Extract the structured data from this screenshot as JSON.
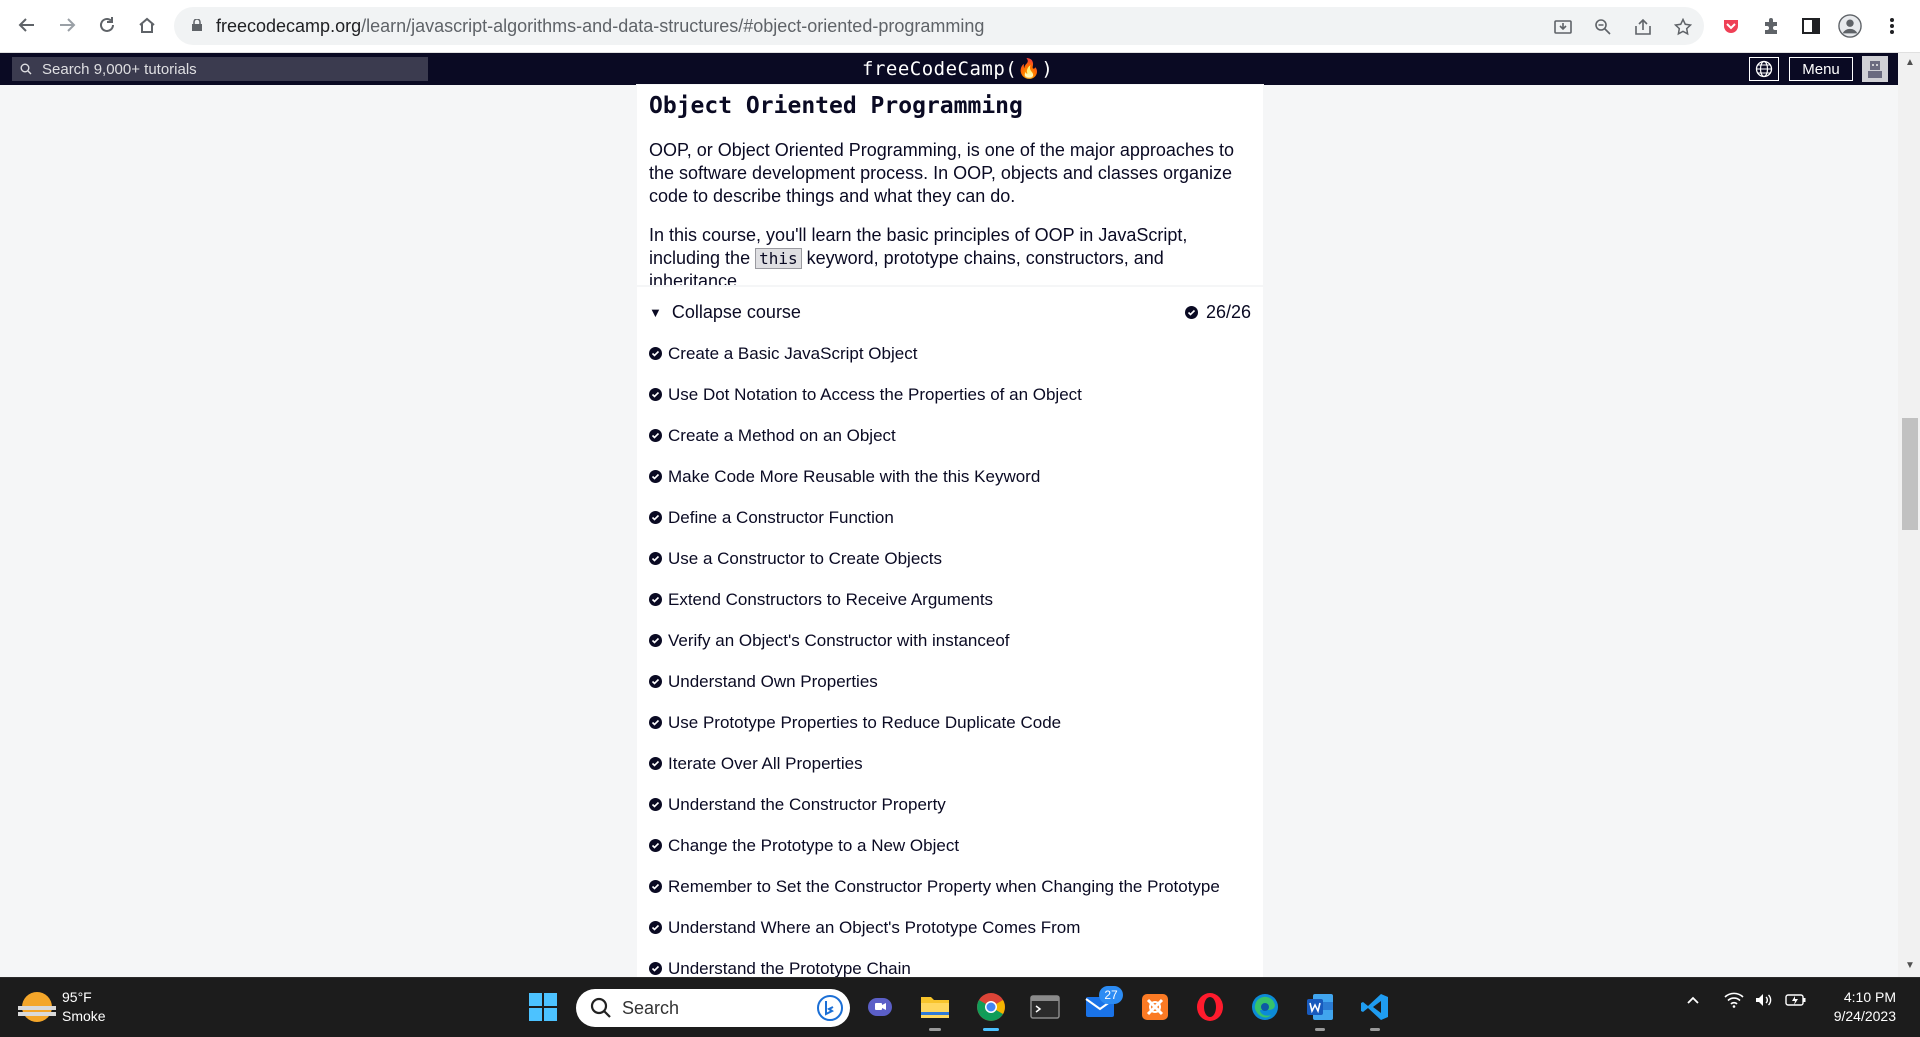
{
  "browser": {
    "url_host": "freecodecamp.org",
    "url_path": "/learn/javascript-algorithms-and-data-structures/#object-oriented-programming",
    "nav_icons": [
      "back-icon",
      "forward-icon",
      "reload-icon",
      "home-icon"
    ],
    "omnibox_icons": [
      "install-icon",
      "zoom-icon",
      "share-icon",
      "bookmark-star-icon"
    ],
    "extension_icons": [
      "pocket-icon",
      "puzzle-extensions-icon",
      "side-panel-icon",
      "profile-icon",
      "more-menu-icon"
    ]
  },
  "fcc_nav": {
    "search_placeholder": "Search 9,000+ tutorials",
    "logo": "freeCodeCamp(🔥)",
    "menu_label": "Menu"
  },
  "course": {
    "title": "Object Oriented Programming",
    "intro": "OOP, or Object Oriented Programming, is one of the major approaches to the software development process. In OOP, objects and classes organize code to describe things and what they can do.",
    "detail_before": "In this course, you'll learn the basic principles of OOP in JavaScript, including the",
    "detail_code": "this",
    "detail_after": "keyword, prototype chains, constructors, and inheritance.",
    "collapse_label": "Collapse course",
    "progress": "26/26",
    "lessons": [
      "Create a Basic JavaScript Object",
      "Use Dot Notation to Access the Properties of an Object",
      "Create a Method on an Object",
      "Make Code More Reusable with the this Keyword",
      "Define a Constructor Function",
      "Use a Constructor to Create Objects",
      "Extend Constructors to Receive Arguments",
      "Verify an Object's Constructor with instanceof",
      "Understand Own Properties",
      "Use Prototype Properties to Reduce Duplicate Code",
      "Iterate Over All Properties",
      "Understand the Constructor Property",
      "Change the Prototype to a New Object",
      "Remember to Set the Constructor Property when Changing the Prototype",
      "Understand Where an Object's Prototype Comes From",
      "Understand the Prototype Chain"
    ]
  },
  "taskbar": {
    "weather_temp": "95°F",
    "weather_desc": "Smoke",
    "search_label": "Search",
    "mail_badge": "27",
    "time": "4:10 PM",
    "date": "9/24/2023",
    "apps": [
      "windows-start-icon",
      "search-icon",
      "chat-icon",
      "file-explorer-icon",
      "chrome-icon",
      "terminal-icon",
      "mail-icon",
      "xampp-icon",
      "opera-icon",
      "edge-icon",
      "word-icon",
      "vscode-icon"
    ],
    "tray_icons": [
      "chevron-up-icon",
      "wifi-icon",
      "volume-icon",
      "battery-icon"
    ]
  },
  "colors": {
    "fcc_dark": "#0a0a23",
    "fcc_search": "#3b3b4f",
    "page_gray": "#f5f6f7",
    "taskbar": "#1c1c1c"
  }
}
